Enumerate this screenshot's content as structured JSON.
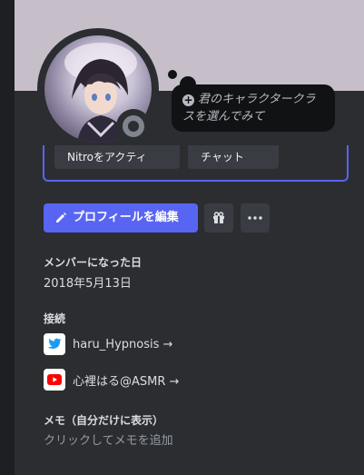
{
  "profile": {
    "status_bubble": "君のキャラクタークラスを選んでみて",
    "edit_button": "プロフィールを編集",
    "partial_buttons": [
      "Nitroをアクティ",
      "チャット"
    ]
  },
  "member_since": {
    "title": "メンバーになった日",
    "date": "2018年5月13日"
  },
  "connections": {
    "title": "接続",
    "items": [
      {
        "service": "twitter",
        "label": "haru_Hypnosis →",
        "icon": "twitter-icon",
        "color": "#1d9bf0"
      },
      {
        "service": "youtube",
        "label": "心裡はる@ASMR →",
        "icon": "youtube-icon",
        "color": "#ff0000"
      }
    ]
  },
  "note": {
    "title": "メモ（自分だけに表示）",
    "placeholder": "クリックしてメモを追加"
  },
  "colors": {
    "accent": "#5865f2",
    "background": "#2b2d31",
    "banner": "#c6bfca"
  }
}
